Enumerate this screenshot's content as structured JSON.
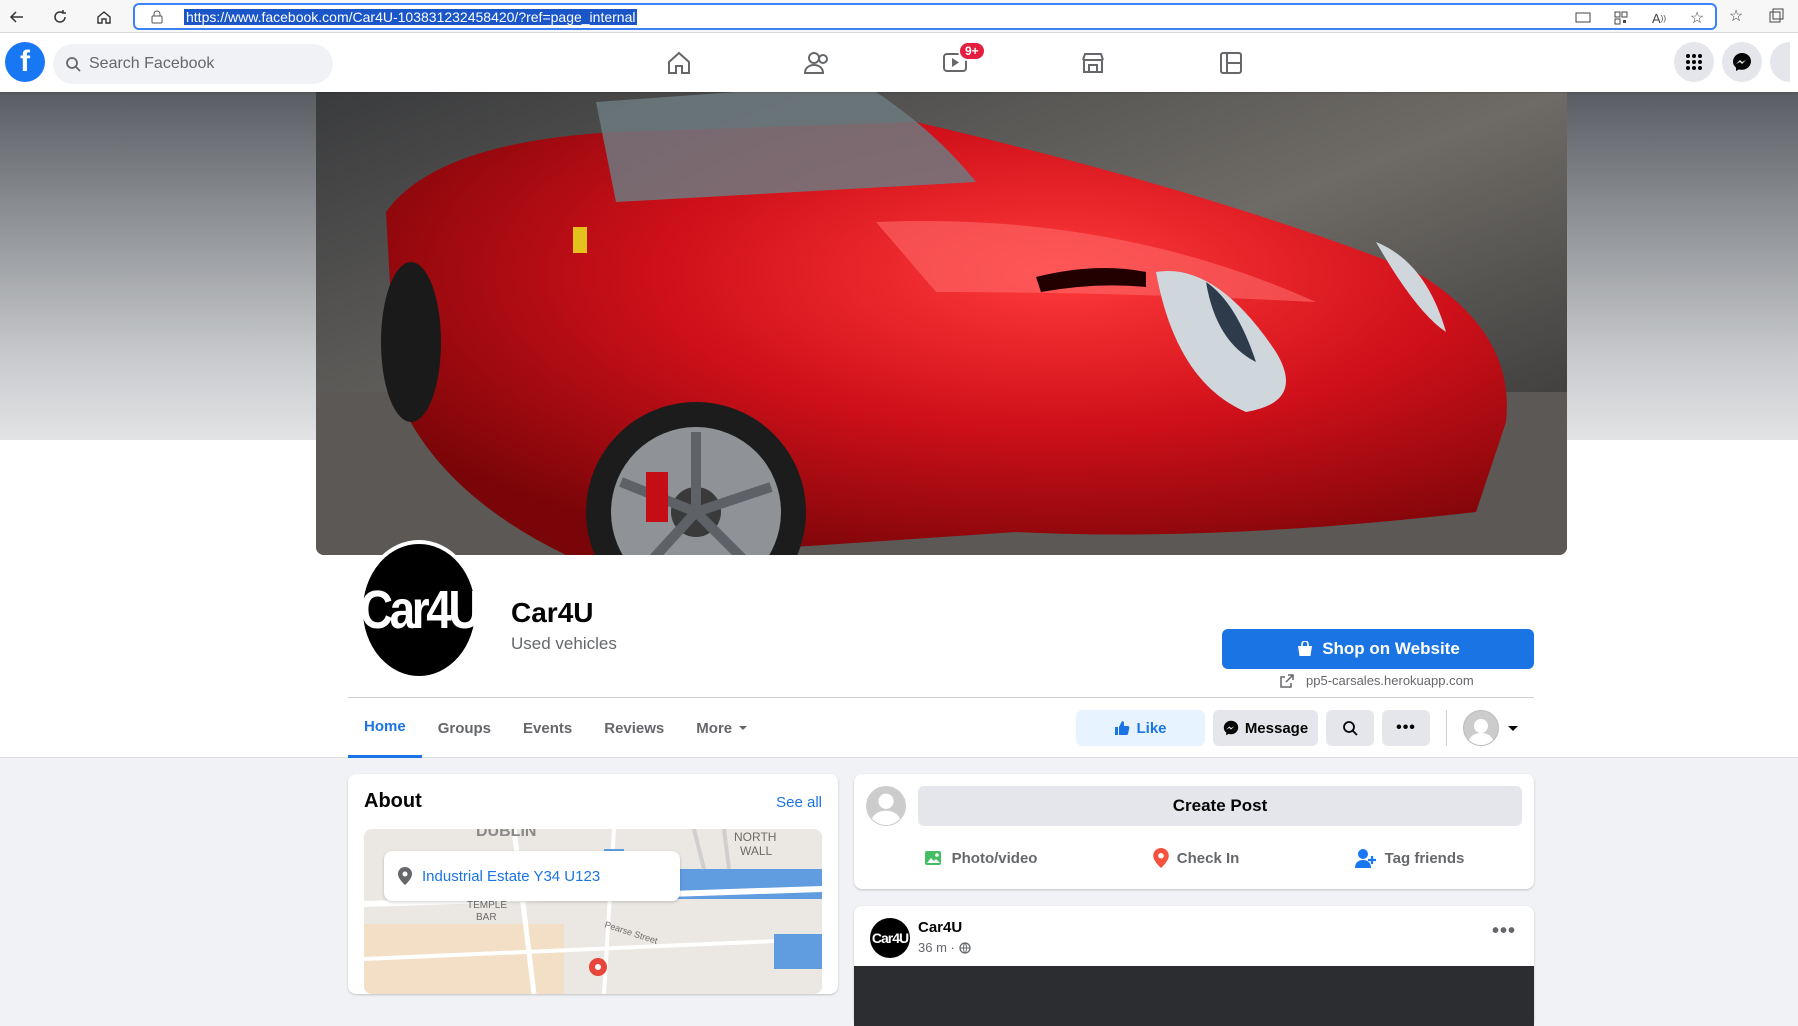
{
  "browser": {
    "url": "https://www.facebook.com/Car4U-103831232458420/?ref=page_internal"
  },
  "fb_nav": {
    "search_placeholder": "Search Facebook",
    "watch_badge": "9+"
  },
  "page": {
    "profile_text": "Car4U",
    "name": "Car4U",
    "category": "Used vehicles",
    "shop_button": "Shop on Website",
    "shop_url": "pp5-carsales.herokuapp.com"
  },
  "tabs": [
    {
      "label": "Home",
      "active": true
    },
    {
      "label": "Groups"
    },
    {
      "label": "Events"
    },
    {
      "label": "Reviews"
    },
    {
      "label": "More"
    }
  ],
  "actions": {
    "like": "Like",
    "message": "Message"
  },
  "about": {
    "title": "About",
    "see_all": "See all",
    "address": "Industrial Estate Y34 U123",
    "map_labels": {
      "dublin": "DUBLIN",
      "north_wall": "NORTH",
      "north_wall2": "WALL",
      "temple": "TEMPLE",
      "bar": "BAR",
      "pearse": "Pearse Street"
    }
  },
  "create_post": {
    "button": "Create Post",
    "photo": "Photo/video",
    "checkin": "Check In",
    "tag": "Tag friends"
  },
  "post": {
    "author": "Car4U",
    "avatar_text": "Car4U",
    "time": "36 m ·"
  },
  "colors": {
    "fb_blue": "#1877f2",
    "primary_button": "#1b74e4",
    "car_red": "#d0101a"
  }
}
